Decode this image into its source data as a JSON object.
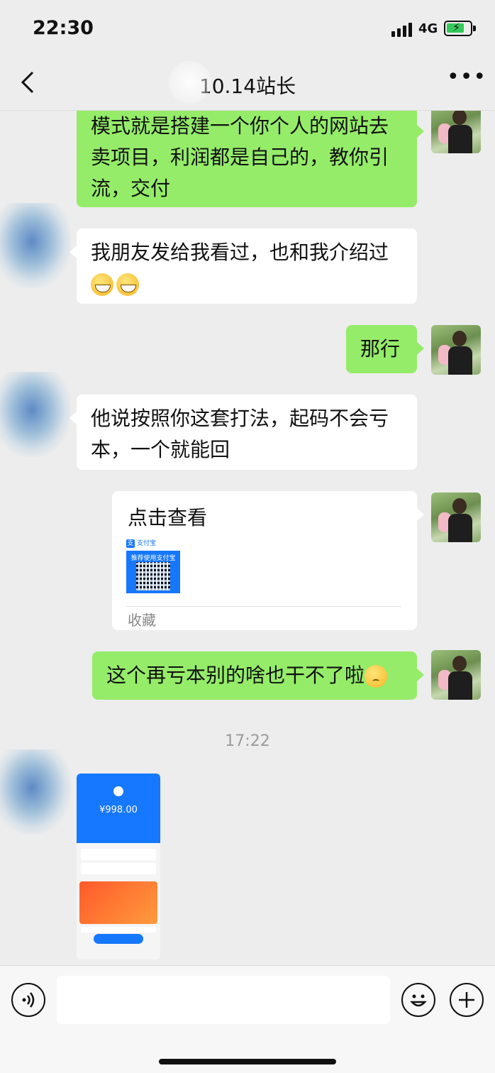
{
  "status_bar": {
    "time": "22:30",
    "network": "4G",
    "icons": [
      "signal-icon",
      "battery-charging-icon"
    ]
  },
  "nav": {
    "title": "10.14站长",
    "back_icon": "chevron-left-icon",
    "more_icon": "more-icon",
    "more_glyph": "•••"
  },
  "messages": [
    {
      "sender": "me",
      "text": "模式就是搭建一个你个人的网站去卖项目，利润都是自己的，教你引流，交付"
    },
    {
      "sender": "other",
      "text": "我朋友发给我看过，也和我介绍过",
      "emoji": [
        "grin-icon",
        "grin-icon"
      ]
    },
    {
      "sender": "me",
      "text": "那行"
    },
    {
      "sender": "other",
      "text": "他说按照你这套打法，起码不会亏本，一个就能回"
    },
    {
      "sender": "me",
      "type": "card",
      "title": "点击查看",
      "qr_brand": "支付宝",
      "qr_caption": "推荐使用支付宝",
      "footer": "收藏"
    },
    {
      "sender": "me",
      "text": "这个再亏本别的啥也干不了啦",
      "emoji": [
        "worried-face-icon"
      ]
    },
    {
      "type": "timestamp",
      "text": "17:22"
    },
    {
      "sender": "other",
      "type": "image",
      "amount": "¥998.00"
    }
  ],
  "input_bar": {
    "voice_icon": "voice-icon",
    "emoji_icon": "emoji-icon",
    "plus_icon": "plus-icon",
    "placeholder": ""
  },
  "colors": {
    "my_bubble": "#95ec69",
    "other_bubble": "#ffffff",
    "background": "#ededed",
    "alipay_blue": "#1677ff"
  }
}
